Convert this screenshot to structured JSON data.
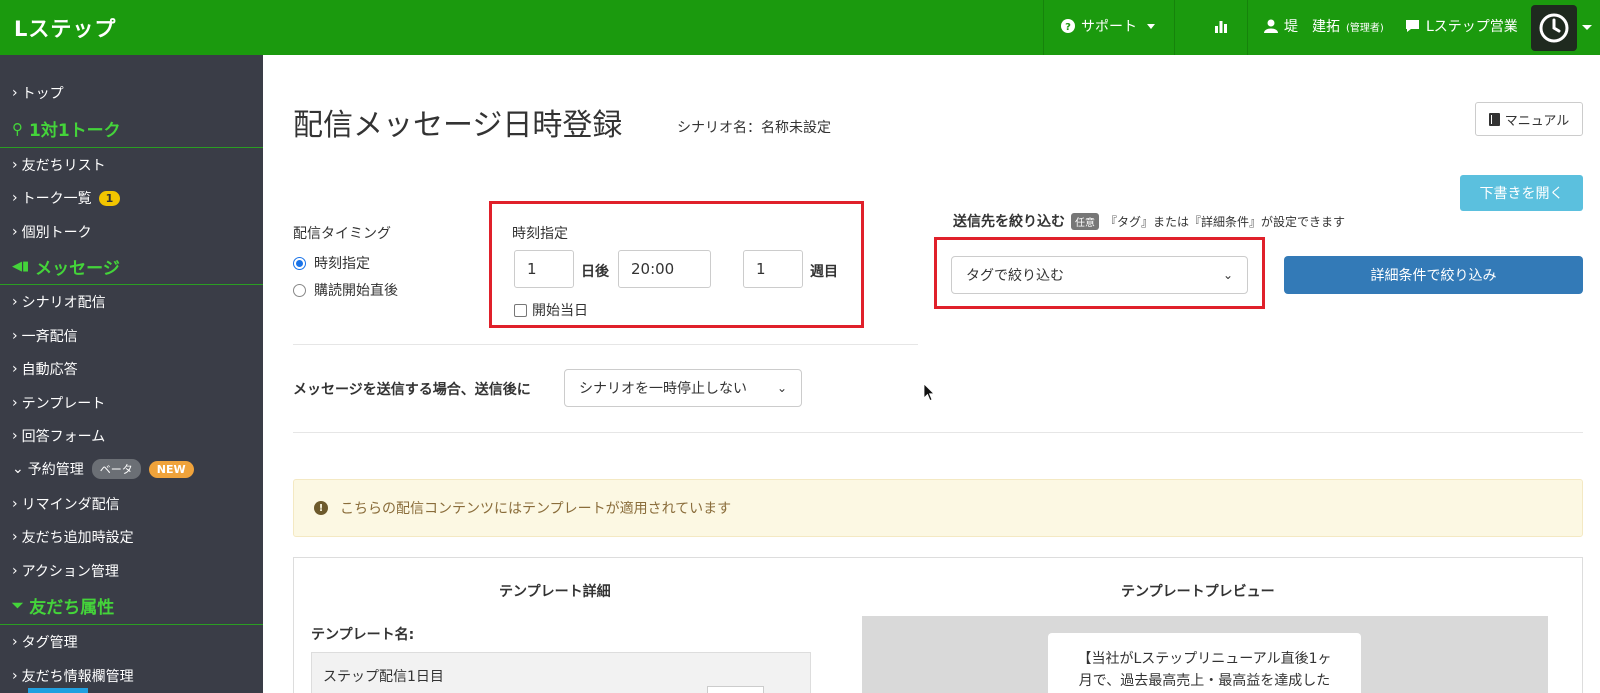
{
  "header": {
    "logo": "Lステップ",
    "support": "サポート",
    "user_name": "堤　建拓",
    "user_role": "(管理者)",
    "account": "Lステップ営業"
  },
  "sidebar": {
    "items": [
      {
        "label": "トップ",
        "type": "link"
      },
      {
        "label": "1対1トーク",
        "type": "section"
      },
      {
        "label": "友だちリスト",
        "type": "link"
      },
      {
        "label": "トーク一覧",
        "type": "link",
        "badge": "1"
      },
      {
        "label": "個別トーク",
        "type": "link"
      },
      {
        "label": "メッセージ",
        "type": "section"
      },
      {
        "label": "シナリオ配信",
        "type": "link"
      },
      {
        "label": "一斉配信",
        "type": "link"
      },
      {
        "label": "自動応答",
        "type": "link"
      },
      {
        "label": "テンプレート",
        "type": "link"
      },
      {
        "label": "回答フォーム",
        "type": "link"
      },
      {
        "label": "予約管理",
        "type": "link",
        "badge_beta": "ベータ",
        "badge_new": "NEW"
      },
      {
        "label": "リマインダ配信",
        "type": "link"
      },
      {
        "label": "友だち追加時設定",
        "type": "link"
      },
      {
        "label": "アクション管理",
        "type": "link"
      },
      {
        "label": "友だち属性",
        "type": "section"
      },
      {
        "label": "タグ管理",
        "type": "link"
      },
      {
        "label": "友だち情報欄管理",
        "type": "link"
      }
    ]
  },
  "main": {
    "title": "配信メッセージ日時登録",
    "scenario_name": "シナリオ名：名称未設定",
    "manual_button": "マニュアル",
    "draft_button": "下書きを開く",
    "timing": {
      "label": "配信タイミング",
      "option_time": "時刻指定",
      "option_after": "購読開始直後"
    },
    "time_spec": {
      "label": "時刻指定",
      "days_value": "1",
      "days_unit": "日後",
      "time_value": "20:00",
      "week_value": "1",
      "week_unit": "週目",
      "start_day_label": "開始当日"
    },
    "filter": {
      "label": "送信先を絞り込む",
      "optional": "任意",
      "desc": "『タグ』または『詳細条件』が設定できます",
      "tag_select": "タグで絞り込む",
      "detail_button": "詳細条件で絞り込み"
    },
    "after_send": {
      "label": "メッセージを送信する場合、送信後に",
      "select": "シナリオを一時停止しない"
    },
    "alert": "こちらの配信コンテンツにはテンプレートが適用されています",
    "template": {
      "detail_heading": "テンプレート詳細",
      "preview_heading": "テンプレートプレビュー",
      "name_label": "テンプレート名:",
      "name_value": "ステップ配信1日目",
      "preview_line1": "【当社がLステップリニューアル直後1ヶ",
      "preview_line2": "月で、過去最高売上・最高益を達成した"
    }
  },
  "colors": {
    "header_green": "#1b9a0e",
    "sidebar_bg": "#3a3d47",
    "sidebar_section": "#44d43a",
    "highlight_red": "#e0202a",
    "primary_blue": "#337ab7",
    "info_blue": "#5bc0de"
  }
}
